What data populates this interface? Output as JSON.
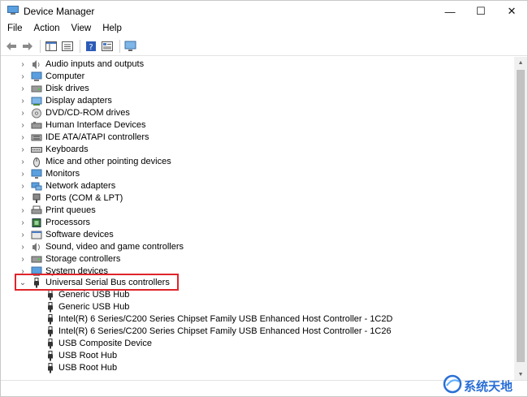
{
  "window": {
    "title": "Device Manager",
    "controls": {
      "minimize": "—",
      "maximize": "☐",
      "close": "✕"
    }
  },
  "menu": [
    "File",
    "Action",
    "View",
    "Help"
  ],
  "toolbar": [
    "back-arrow-icon",
    "forward-arrow-icon",
    "properties-pane-icon",
    "list-view-icon",
    "help-icon",
    "properties-icon",
    "monitor-scan-icon"
  ],
  "tree": {
    "categories": [
      {
        "label": "Audio inputs and outputs",
        "icon": "speaker-icon"
      },
      {
        "label": "Computer",
        "icon": "computer-icon"
      },
      {
        "label": "Disk drives",
        "icon": "disk-drive-icon"
      },
      {
        "label": "Display adapters",
        "icon": "display-adapter-icon"
      },
      {
        "label": "DVD/CD-ROM drives",
        "icon": "dvd-drive-icon"
      },
      {
        "label": "Human Interface Devices",
        "icon": "hid-icon"
      },
      {
        "label": "IDE ATA/ATAPI controllers",
        "icon": "ide-controller-icon"
      },
      {
        "label": "Keyboards",
        "icon": "keyboard-icon"
      },
      {
        "label": "Mice and other pointing devices",
        "icon": "mouse-icon"
      },
      {
        "label": "Monitors",
        "icon": "monitor-icon"
      },
      {
        "label": "Network adapters",
        "icon": "network-adapter-icon"
      },
      {
        "label": "Ports (COM & LPT)",
        "icon": "port-icon"
      },
      {
        "label": "Print queues",
        "icon": "printer-icon"
      },
      {
        "label": "Processors",
        "icon": "processor-icon"
      },
      {
        "label": "Software devices",
        "icon": "software-device-icon"
      },
      {
        "label": "Sound, video and game controllers",
        "icon": "sound-icon"
      },
      {
        "label": "Storage controllers",
        "icon": "storage-controller-icon"
      },
      {
        "label": "System devices",
        "icon": "system-device-icon"
      }
    ],
    "expanded": {
      "label": "Universal Serial Bus controllers",
      "icon": "usb-icon",
      "children": [
        "Generic USB Hub",
        "Generic USB Hub",
        "Intel(R) 6 Series/C200 Series Chipset Family USB Enhanced Host Controller - 1C2D",
        "Intel(R) 6 Series/C200 Series Chipset Family USB Enhanced Host Controller - 1C26",
        "USB Composite Device",
        "USB Root Hub",
        "USB Root Hub"
      ]
    }
  },
  "watermark": {
    "text": "系统天地"
  }
}
